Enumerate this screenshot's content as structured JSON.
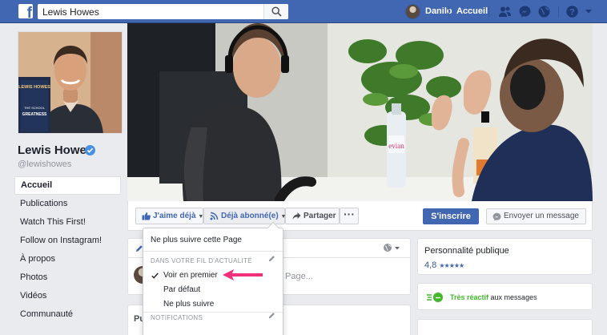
{
  "topbar": {
    "search_value": "Lewis Howes",
    "user_name": "Danilo",
    "home_label": "Accueil",
    "icons": [
      "friends-icon",
      "messenger-icon",
      "globe-notifications-icon",
      "help-icon",
      "caret-down-icon"
    ]
  },
  "page": {
    "name": "Lewis Howes",
    "handle": "@lewishowes",
    "book_title_lines": [
      "LEWIS HOWES",
      "THE SCHOOL",
      "GREATNESS"
    ]
  },
  "left_nav": [
    {
      "label": "Accueil",
      "active": true
    },
    {
      "label": "Publications"
    },
    {
      "label": "Watch This First!"
    },
    {
      "label": "Follow on Instagram!"
    },
    {
      "label": "À propos"
    },
    {
      "label": "Photos"
    },
    {
      "label": "Vidéos"
    },
    {
      "label": "Communauté"
    }
  ],
  "cover": {
    "bottle_brand": "evian"
  },
  "actions": {
    "like_label": "J'aime déjà",
    "follow_label": "Déjà abonné(e)",
    "share_label": "Partager",
    "more_label": "···",
    "signup_label": "S'inscrire",
    "message_label": "Envoyer un message"
  },
  "dropdown": {
    "unfollow_label": "Ne plus suivre cette Page",
    "feed_section": "DANS VOTRE FIL D'ACTUALITÉ",
    "see_first_label": "Voir en premier",
    "default_label": "Par défaut",
    "stop_following_label": "Ne plus suivre",
    "notifications_section": "NOTIFICATIONS"
  },
  "composer": {
    "placeholder_fragment": "Page..."
  },
  "posts": {
    "title_fragment": "Pu"
  },
  "sidebar": {
    "category": "Personnalité publique",
    "rating": "4,8",
    "stars": "★★★★★",
    "responsiveness_strong": "Très réactif",
    "responsiveness_rest": "aux messages"
  },
  "colors": {
    "topbar": "#4267b2",
    "accent_blue": "#4267b2",
    "annotation_arrow": "#f0307a",
    "responsive_green": "#42b72a"
  }
}
